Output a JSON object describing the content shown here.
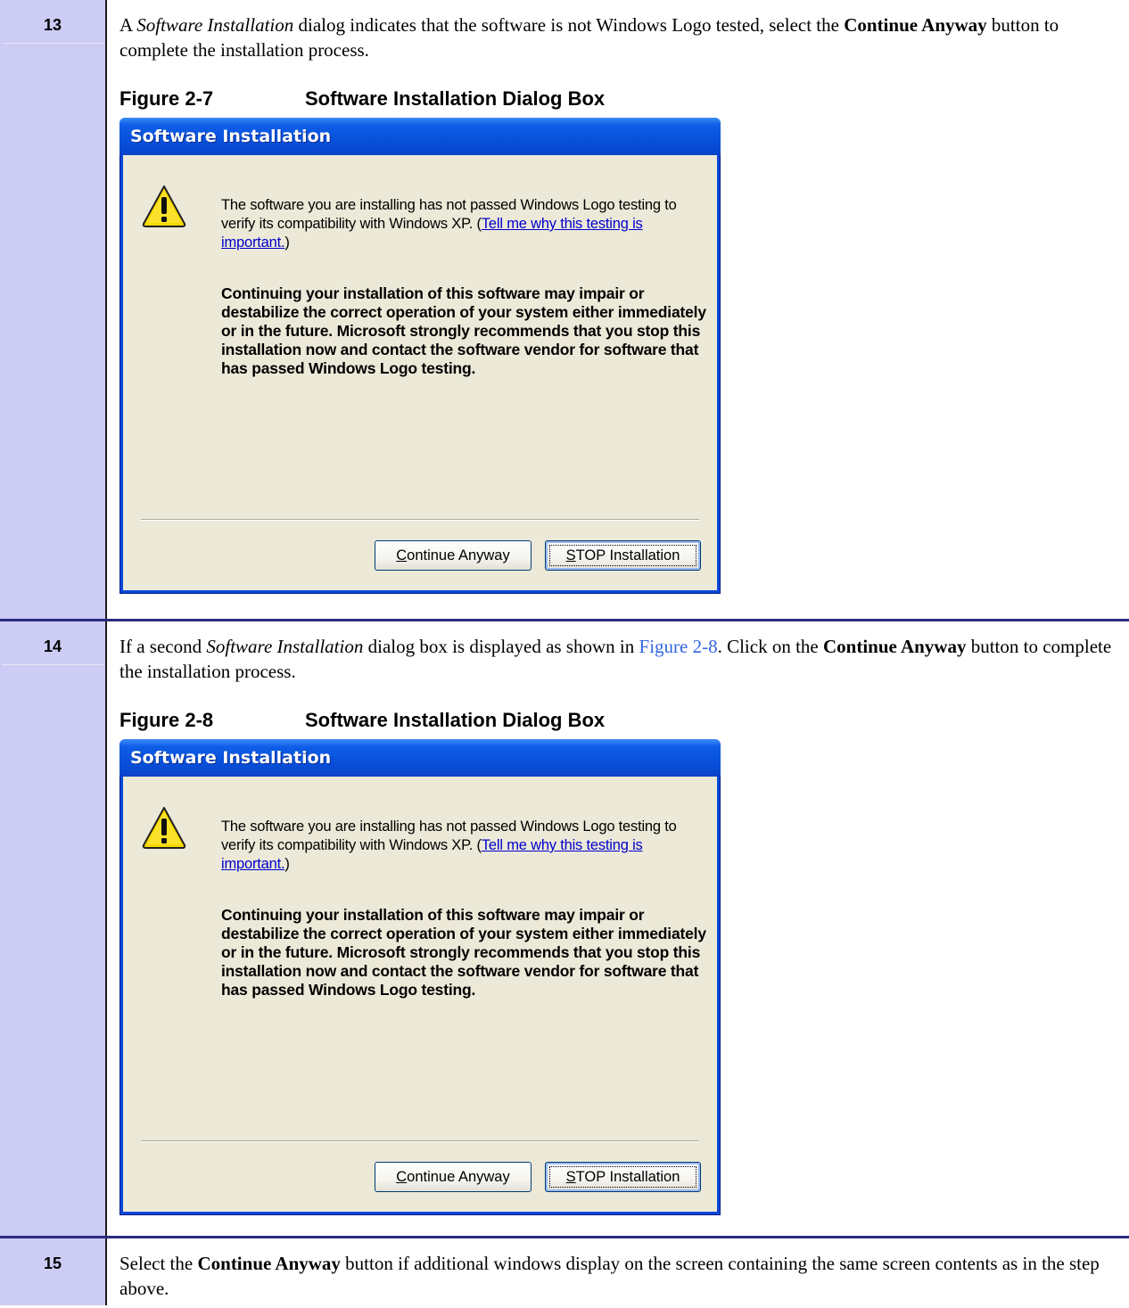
{
  "steps": [
    {
      "number": "13",
      "text": {
        "t1": "A ",
        "i1": "Software Installation",
        "t2": " dialog indicates that the software is not Windows Logo tested, select the ",
        "b1": "Continue Anyway",
        "t3": " button to complete the installation process."
      },
      "figure": {
        "number": "Figure 2-7",
        "title": "Software Installation Dialog Box",
        "dialog": {
          "title": "Software Installation",
          "icon": "warning-icon",
          "message": "The software you are installing has not passed Windows Logo testing to verify its compatibility with Windows XP. (",
          "link": "Tell me why this testing is important.",
          "message_end": ")",
          "warning": "Continuing your installation of this software may impair or destabilize the correct operation of your system either immediately or in the future. Microsoft strongly recommends that you stop this installation now and contact the software vendor for software that has passed Windows Logo testing.",
          "continue_first": "C",
          "continue_rest": "ontinue Anyway",
          "stop_first": "S",
          "stop_rest": "TOP Installation"
        }
      }
    },
    {
      "number": "14",
      "text": {
        "t1": "If a second ",
        "i1": "Software Installation",
        "t2": " dialog box is displayed as shown in ",
        "xref": "Figure 2-8",
        "t3": ".  Click on the ",
        "b1": "Continue Anyway",
        "t4": " button to complete the installation process."
      },
      "figure": {
        "number": "Figure 2-8",
        "title": "Software Installation Dialog Box",
        "dialog": {
          "title": "Software Installation",
          "icon": "warning-icon",
          "message": "The software you are installing has not passed Windows Logo testing to verify its compatibility with Windows XP. (",
          "link": "Tell me why this testing is important.",
          "message_end": ")",
          "warning": "Continuing your installation of this software may impair or destabilize the correct operation of your system either immediately or in the future. Microsoft strongly recommends that you stop this installation now and contact the software vendor for software that has passed Windows Logo testing.",
          "continue_first": "C",
          "continue_rest": "ontinue Anyway",
          "stop_first": "S",
          "stop_rest": "TOP Installation"
        }
      }
    },
    {
      "number": "15",
      "text": {
        "t1": "Select the ",
        "b1": "Continue Anyway",
        "t2": " button if additional windows display on the screen containing the same screen contents as in the step above."
      }
    }
  ],
  "colors": {
    "step_column": "#ccccf4",
    "row_rule": "#2b2b80",
    "xref": "#3366e0",
    "xp_titlebar": "#0852dc",
    "xp_client": "#ece9d8"
  }
}
